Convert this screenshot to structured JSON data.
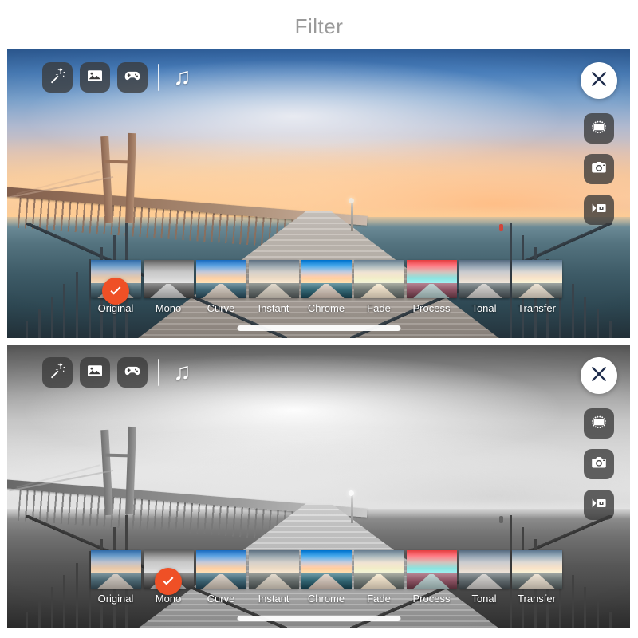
{
  "header": {
    "title": "Filter"
  },
  "colors": {
    "accent_orange": "#ef5026",
    "title_gray": "#9a9a9a",
    "button_dark": "rgba(58,58,58,0.78)",
    "close_bg": "#ffffff",
    "check_white": "#ffffff"
  },
  "toolbar": {
    "items": [
      {
        "name": "magic-wand-icon",
        "label": "Magic Wand"
      },
      {
        "name": "photo-icon",
        "label": "Photos"
      },
      {
        "name": "game-controller-icon",
        "label": "Games"
      }
    ],
    "divider": "|",
    "music_icon": "♫"
  },
  "right_rail": {
    "close_label": "✕",
    "items": [
      {
        "name": "rotate-crop-icon",
        "label": "Rotate"
      },
      {
        "name": "camera-icon",
        "label": "Camera"
      },
      {
        "name": "video-camera-icon",
        "label": "Video"
      }
    ]
  },
  "filters": [
    {
      "label": "Original",
      "class": ""
    },
    {
      "label": "Mono",
      "class": "f-mono"
    },
    {
      "label": "Curve",
      "class": "f-curve"
    },
    {
      "label": "Instant",
      "class": "f-instant"
    },
    {
      "label": "Chrome",
      "class": "f-chrome"
    },
    {
      "label": "Fade",
      "class": "f-fade"
    },
    {
      "label": "Process",
      "class": "f-process"
    },
    {
      "label": "Tonal",
      "class": "f-tonal"
    },
    {
      "label": "Transfer",
      "class": "f-transfer"
    }
  ],
  "panels": [
    {
      "name": "panel-original",
      "selected_filter": "Original",
      "selected_index": 0,
      "mono": false
    },
    {
      "name": "panel-mono",
      "selected_filter": "Mono",
      "selected_index": 1,
      "mono": true
    }
  ]
}
